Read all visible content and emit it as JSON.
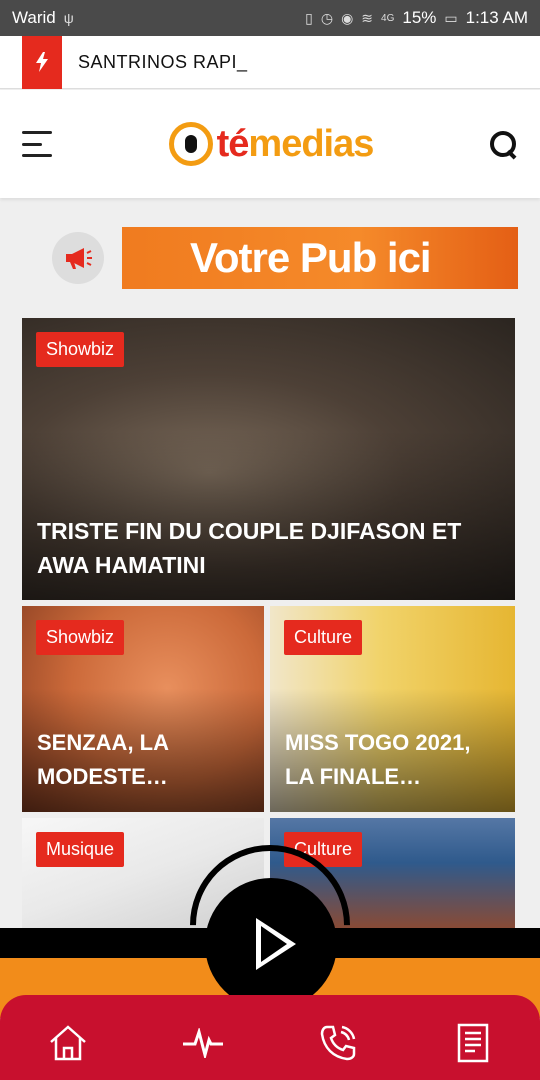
{
  "status_bar": {
    "carrier": "Warid",
    "network": "4G",
    "battery": "15%",
    "time": "1:13 AM"
  },
  "ticker": {
    "text": "SANTRINOS RAPI_"
  },
  "header": {
    "logo_te": "té",
    "logo_medias": "medias"
  },
  "ad": {
    "text": "Votre Pub ici"
  },
  "articles": [
    {
      "category": "Showbiz",
      "title": "TRISTE FIN DU COUPLE DJIFASON ET AWA HAMATINI"
    },
    {
      "category": "Showbiz",
      "title": "SENZAA, LA MODESTE…"
    },
    {
      "category": "Culture",
      "title": "MISS TOGO 2021, LA FINALE…"
    },
    {
      "category": "Musique",
      "title": ""
    },
    {
      "category": "Culture",
      "title": ""
    }
  ],
  "colors": {
    "accent_red": "#e52a1e",
    "brand_orange": "#f39c12",
    "nav_red": "#c8102e"
  },
  "icons": {
    "ticker": "bolt-icon",
    "ad": "megaphone-icon",
    "nav": [
      "home-icon",
      "pulse-icon",
      "phone-icon",
      "document-icon"
    ]
  }
}
